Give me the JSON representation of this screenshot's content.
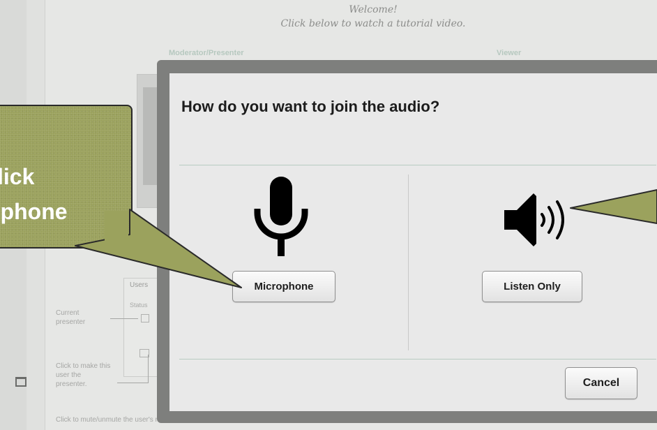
{
  "background": {
    "welcome_line1": "Welcome!",
    "welcome_line2": "Click below to watch a tutorial video.",
    "moderator_label": "Moderator/Presenter",
    "viewer_label": "Viewer",
    "users_title": "Users",
    "status_label": "Status",
    "note_current_presenter": "Current presenter",
    "note_make_presenter": "Click to make this user the presenter.",
    "note_mute": "Click to mute/unmute the user's microphone."
  },
  "modal": {
    "title": "How do you want to join the audio?",
    "microphone_label": "Microphone",
    "listen_only_label": "Listen Only",
    "cancel_label": "Cancel",
    "icons": [
      "microphone-icon",
      "speaker-icon"
    ]
  },
  "callout": {
    "line1": "lick",
    "line2": "ophone",
    "color": "#9ba25d"
  }
}
